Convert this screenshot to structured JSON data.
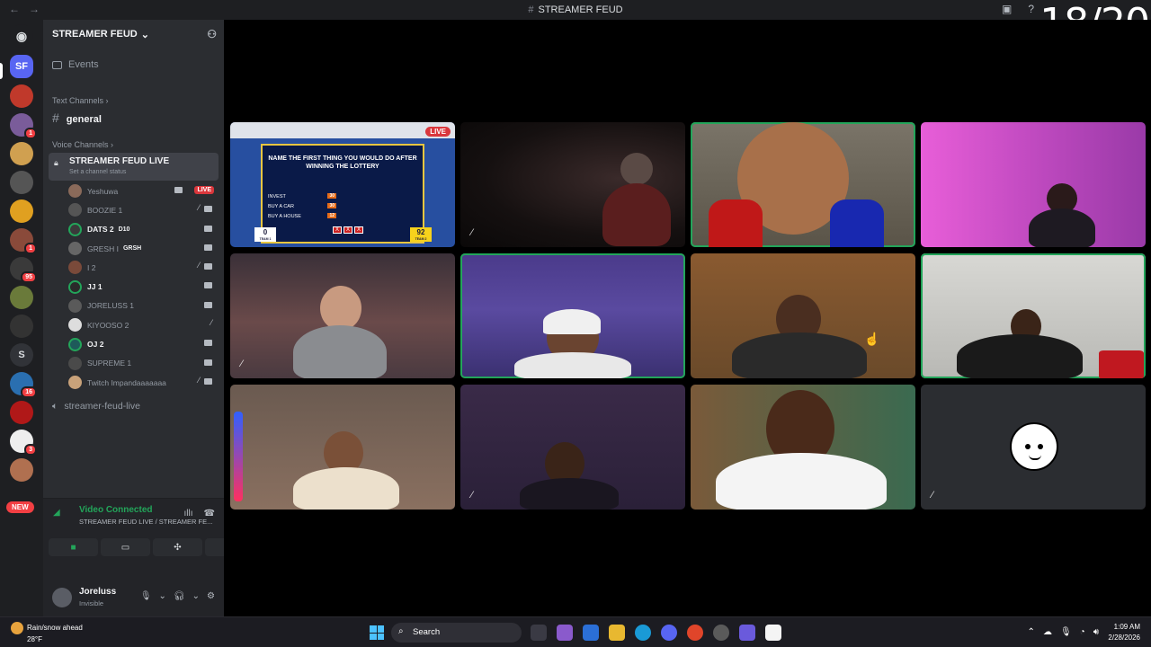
{
  "window": {
    "title": "STREAMER FEUD",
    "counter": "18/20"
  },
  "server": {
    "name": "STREAMER FEUD",
    "header_icon_initials": "SF"
  },
  "sidebar": {
    "events_label": "Events",
    "text_category": "Text Channels",
    "text_channel": "general",
    "voice_category": "Voice Channels",
    "voice_channel": "STREAMER FEUD LIVE",
    "voice_channel_status": "Set a channel status",
    "members": [
      {
        "name": "Yeshuwa",
        "live": "LIVE"
      },
      {
        "name": "BOOZIE 1"
      },
      {
        "name": "DATS 2",
        "tag": "D10"
      },
      {
        "name": "GRESH I",
        "tag": "GRSH"
      },
      {
        "name": "I 2"
      },
      {
        "name": "JJ 1"
      },
      {
        "name": "JORELUSS 1"
      },
      {
        "name": "KIYOOSO 2"
      },
      {
        "name": "OJ 2"
      },
      {
        "name": "SUPREME 1"
      },
      {
        "name": "Twitch Impandaaaaaaa"
      }
    ],
    "second_voice_channel": "streamer-feud-live"
  },
  "servers": {
    "dm_initial": "S",
    "new_badge": "NEW",
    "badges": [
      "1",
      "1",
      "1",
      "95",
      "16",
      "3"
    ]
  },
  "voice_panel": {
    "status": "Video Connected",
    "subtitle": "STREAMER FEUD LIVE / STREAMER FE..."
  },
  "user": {
    "name": "Joreluss",
    "status": "Invisible"
  },
  "game": {
    "live_badge": "LIVE",
    "question": "NAME THE FIRST THING YOU WOULD DO AFTER WINNING THE LOTTERY",
    "answers": [
      {
        "label": "INVEST",
        "points": "30"
      },
      {
        "label": "BUY A CAR",
        "points": "30"
      },
      {
        "label": "BUY A HOUSE",
        "points": "12"
      }
    ],
    "team1_score": "0",
    "team2_score": "92",
    "team1_label": "TEAM 1",
    "team2_label": "TEAM 2"
  },
  "taskbar": {
    "weather_title": "Rain/snow ahead",
    "weather_temp": "28°F",
    "search_placeholder": "Search",
    "time": "1:09 AM",
    "date": "2/28/2026"
  },
  "colors": {
    "accent_green": "#23a55a",
    "live_red": "#da373c",
    "sidebar_bg": "#2b2d31",
    "server_bg": "#1e1f22"
  }
}
